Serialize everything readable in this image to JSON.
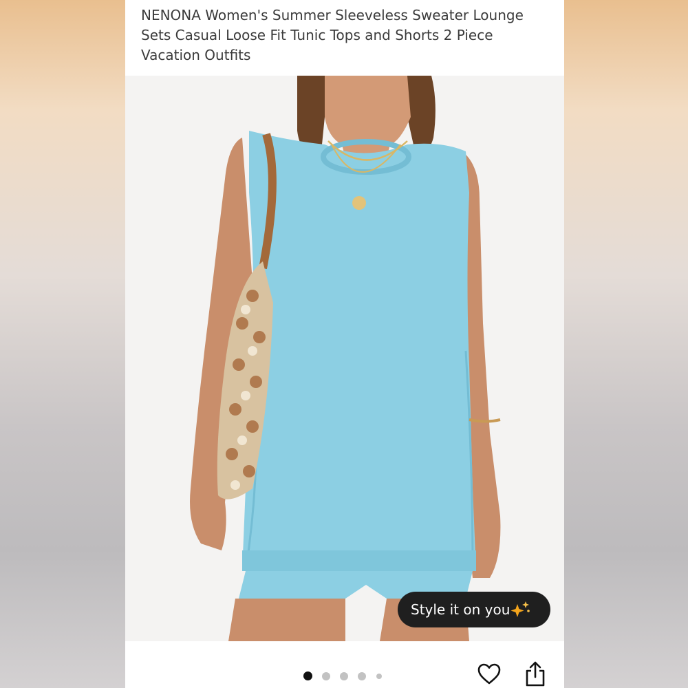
{
  "product": {
    "title": "NENONA Women's Summer Sleeveless Sweater Lounge Sets Casual Loose Fit Tunic Tops and Shorts 2 Piece Vacation Outfits"
  },
  "image": {
    "subject": "product-photo-model",
    "colors": {
      "garment": "#8ccfe3",
      "garment_shade": "#74bdd4",
      "skin": "#c98e6b",
      "hair": "#6b4326",
      "bag": "#d8c2a0",
      "bag_pattern": "#b07a4f",
      "strap": "#a3693a",
      "background": "#f4f3f2"
    }
  },
  "style_button": {
    "label": "Style it on you",
    "icon": "sparkle-icon",
    "accent": "#f4a51c"
  },
  "carousel": {
    "count": 5,
    "active_index": 0
  },
  "actions": {
    "favorite_icon": "heart-icon",
    "share_icon": "share-icon"
  },
  "page": {
    "background_accent": "#e9bf8f"
  }
}
